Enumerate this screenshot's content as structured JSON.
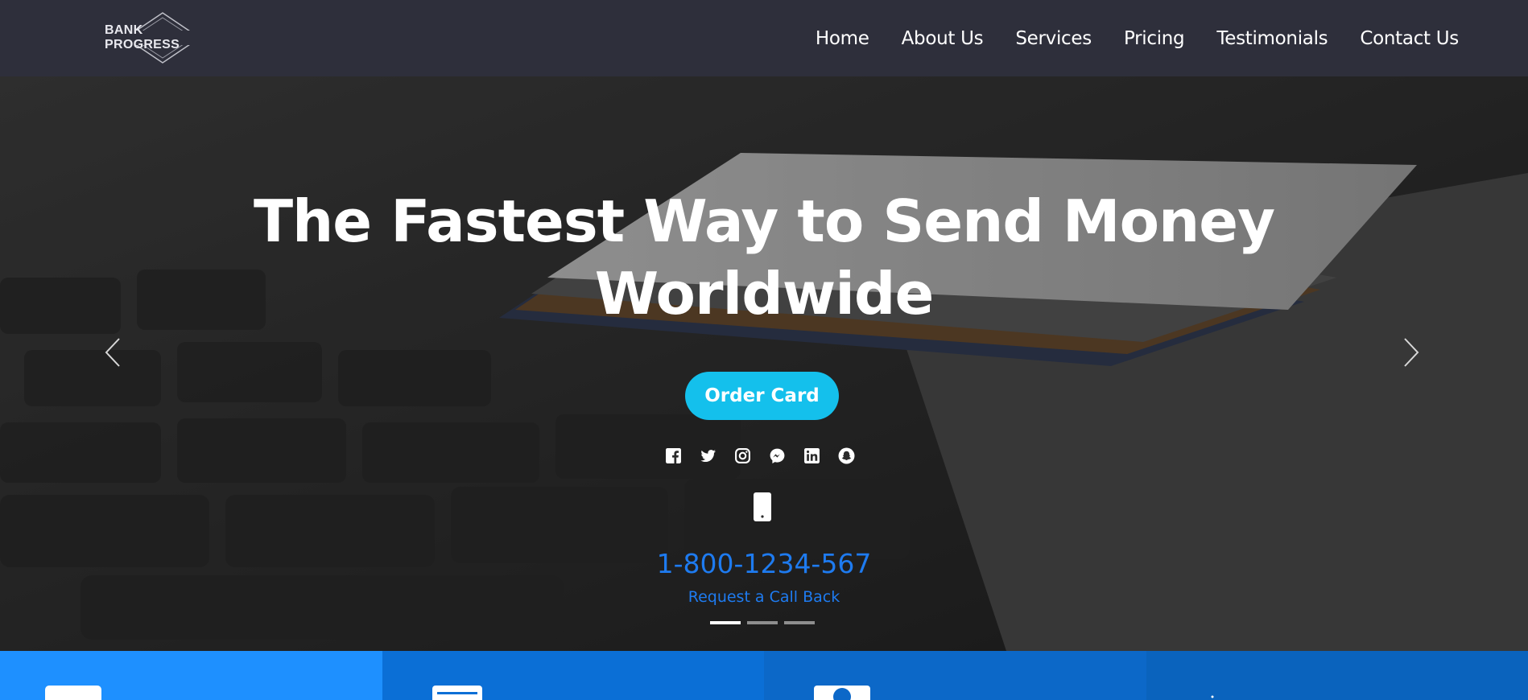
{
  "brand": {
    "logo_text": "BANK PROGRESS"
  },
  "nav": {
    "items": [
      {
        "label": "Home"
      },
      {
        "label": "About Us"
      },
      {
        "label": "Services"
      },
      {
        "label": "Pricing"
      },
      {
        "label": "Testimonials"
      },
      {
        "label": "Contact Us"
      }
    ]
  },
  "hero": {
    "title_line1": "The Fastest Way to Send Money",
    "title_line2": "Worldwide",
    "cta_label": "Order Card",
    "socials": [
      "facebook-icon",
      "twitter-icon",
      "instagram-icon",
      "messenger-icon",
      "linkedin-icon",
      "snapchat-icon"
    ],
    "phone_icon": "mobile-phone-icon",
    "phone_number": "1-800-1234-567",
    "callback_label": "Request a Call Back",
    "slides": {
      "count": 3,
      "active_index": 0
    },
    "arrows": [
      "chevron-left-icon",
      "chevron-right-icon"
    ]
  },
  "features": {
    "colors": [
      "#1e90ff",
      "#0b6fd6",
      "#0c68c8",
      "#0a63bd"
    ],
    "icons": [
      "card-icon",
      "document-icon",
      "globe-card-icon",
      "arrow-icon"
    ]
  },
  "colors": {
    "navbar_bg": "#2e2f3b",
    "accent": "#14c0ec",
    "link_blue": "#1e7bf0"
  }
}
